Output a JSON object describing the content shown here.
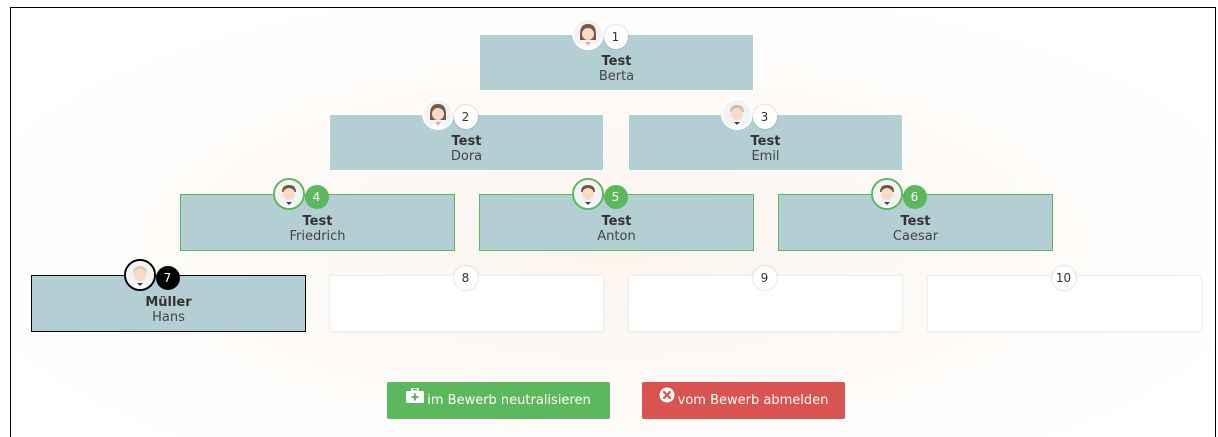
{
  "slots": [
    {
      "num": "1",
      "last": "Test",
      "first": "Berta",
      "state": "filled",
      "avatar": "female-avatar-icon"
    },
    {
      "num": "2",
      "last": "Test",
      "first": "Dora",
      "state": "filled",
      "avatar": "female-avatar-icon"
    },
    {
      "num": "3",
      "last": "Test",
      "first": "Emil",
      "state": "filled",
      "avatar": "male-avatar-icon"
    },
    {
      "num": "4",
      "last": "Test",
      "first": "Friedrich",
      "state": "green",
      "avatar": "male-avatar-icon"
    },
    {
      "num": "5",
      "last": "Test",
      "first": "Anton",
      "state": "green",
      "avatar": "male-avatar-icon"
    },
    {
      "num": "6",
      "last": "Test",
      "first": "Caesar",
      "state": "green",
      "avatar": "male-avatar-icon"
    },
    {
      "num": "7",
      "last": "Müller",
      "first": "Hans",
      "state": "black",
      "avatar": "male-avatar-icon"
    },
    {
      "num": "8",
      "last": "",
      "first": "",
      "state": "empty"
    },
    {
      "num": "9",
      "last": "",
      "first": "",
      "state": "empty"
    },
    {
      "num": "10",
      "last": "",
      "first": "",
      "state": "empty"
    }
  ],
  "buttons": {
    "neutralize": {
      "label": "im Bewerb neutralisieren",
      "icon": "medical-kit-icon",
      "color": "#5cb85c"
    },
    "deregister": {
      "label": "vom Bewerb abmelden",
      "icon": "times-circle-icon",
      "color": "#d9534f"
    }
  },
  "colors": {
    "slot_bg": "#b3cfd4",
    "green": "#5cb85c",
    "red": "#d9534f"
  }
}
